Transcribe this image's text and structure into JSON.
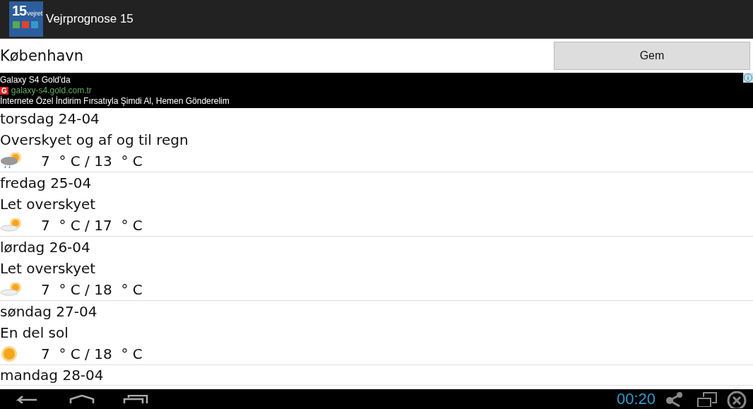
{
  "app_bar": {
    "title": "Vejrprognose 15",
    "logo": {
      "number": "15",
      "word": "vejret"
    }
  },
  "location": {
    "value": "København",
    "button": "Gem"
  },
  "ad": {
    "headline": "Galaxy S4 Gold'da",
    "badge": "G",
    "url": "galaxy-s4.gold.com.tr",
    "text": "İnternete Özel İndirim Fırsatıyla Şimdi Al, Hemen Gönderelim"
  },
  "days": [
    {
      "date": "torsdag 24-04",
      "summary": "Overskyet og af og til regn",
      "kind": "rain",
      "temperature": "7  ° C / 13  ° C"
    },
    {
      "date": "fredag 25-04",
      "summary": "Let overskyet",
      "kind": "partly_cloudy",
      "temperature": "7  ° C / 17  ° C"
    },
    {
      "date": "lørdag 26-04",
      "summary": "Let overskyet",
      "kind": "partly_cloudy",
      "temperature": "7  ° C / 18  ° C"
    },
    {
      "date": "søndag 27-04",
      "summary": "En del sol",
      "kind": "sunny",
      "temperature": "7  ° C / 18  ° C"
    },
    {
      "date": "mandag 28-04"
    }
  ],
  "nav_bar": {
    "clock": "00:20"
  }
}
